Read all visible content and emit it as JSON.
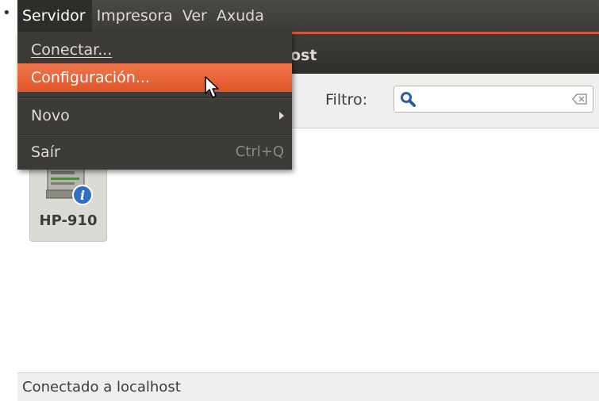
{
  "menubar": {
    "items": [
      "Servidor",
      "Impresora",
      "Ver",
      "Axuda"
    ]
  },
  "window": {
    "title": "ost"
  },
  "toolbar": {
    "filter_label": "Filtro:",
    "search_icon": "search-icon",
    "clear_icon": "clear-icon"
  },
  "menu": {
    "items": [
      {
        "label": "Conectar...",
        "mnemonic_index": 1
      },
      {
        "label": "Configuración...",
        "mnemonic_index": 0,
        "highlighted": true
      },
      {
        "label": "Novo",
        "mnemonic_index": 0,
        "submenu": true
      },
      {
        "label": "Saír",
        "mnemonic_index": 0,
        "accelerator": "Ctrl+Q"
      }
    ]
  },
  "printers": [
    {
      "name": "HP-910",
      "icon": "printer-info-icon"
    }
  ],
  "status": {
    "text": "Conectado a localhost"
  },
  "bullet": "•",
  "colors": {
    "menubar_bg": "#3c3b37",
    "highlight": "#e9673c",
    "content_bg": "#ffffff"
  }
}
